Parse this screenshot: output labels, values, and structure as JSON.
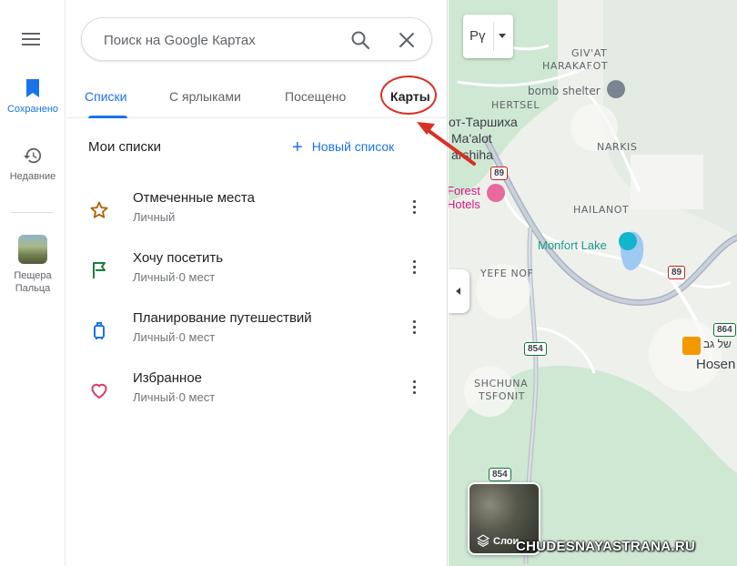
{
  "rail": {
    "saved_label": "Сохранено",
    "recent_label": "Недавние",
    "place_label": "Пещера Пальца"
  },
  "search": {
    "placeholder": "Поиск на Google Картах"
  },
  "tabs": [
    {
      "label": "Списки",
      "active": true
    },
    {
      "label": "С ярлыками",
      "active": false
    },
    {
      "label": "Посещено",
      "active": false
    },
    {
      "label": "Карты",
      "active": false
    }
  ],
  "lists": {
    "title": "Мои списки",
    "new_list_label": "Новый список",
    "items": [
      {
        "title": "Отмеченные места",
        "subtitle": "Личный",
        "icon": "star-icon",
        "color": "#b06000"
      },
      {
        "title": "Хочу посетить",
        "subtitle": "Личный·0 мест",
        "icon": "flag-icon",
        "color": "#188038"
      },
      {
        "title": "Планирование путешествий",
        "subtitle": "Личный·0 мест",
        "icon": "suitcase-icon",
        "color": "#1a73e8"
      },
      {
        "title": "Избранное",
        "subtitle": "Личный·0 мест",
        "icon": "heart-icon",
        "color": "#d93e69"
      }
    ]
  },
  "map": {
    "language_button": "Рү",
    "layers_label": "Слои",
    "labels": {
      "givat_harakafot_1": "GIV'AT",
      "givat_harakafot_2": "HARAKAFOT",
      "bomb_shelter": "bomb shelter",
      "hertsel": "HERTSEL",
      "maalot_1": "от-Таршиха",
      "maalot_2": "Ma'alot",
      "maalot_3": "arshiha",
      "narkis": "NARKIS",
      "forest_hotels_1": "Forest",
      "forest_hotels_2": "Hotels",
      "hailanot": "HAILANOT",
      "monfort_lake": "Monfort Lake",
      "yefe_nof": "YEFE NOF",
      "hebrew_place": "של גב",
      "hosen": "Hosen",
      "shchuna_1": "SHCHUNA",
      "shchuna_2": "TSFONIT"
    },
    "road_shields": [
      "89",
      "89",
      "854",
      "864",
      "854"
    ]
  },
  "watermark": "CHUDESNAYASTRANA.RU",
  "colors": {
    "accent": "#1a73e8",
    "annotation": "#d93025"
  }
}
